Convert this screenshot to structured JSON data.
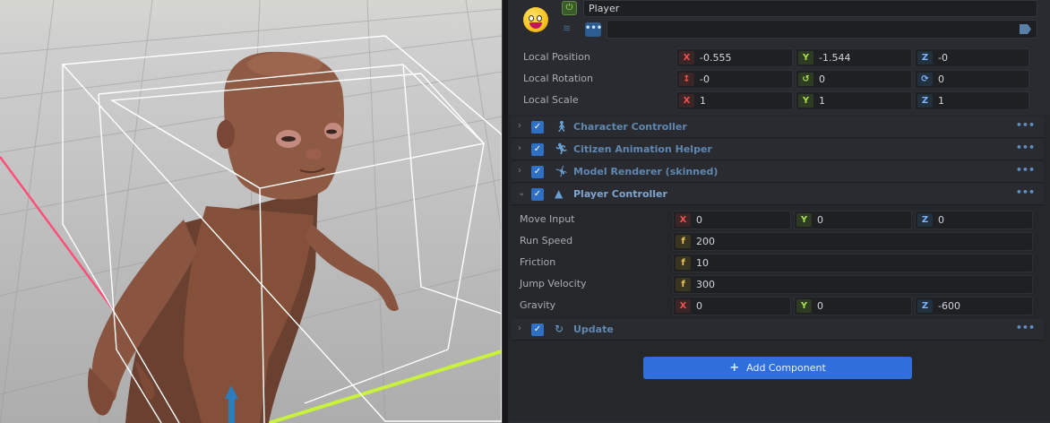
{
  "game_object": {
    "name": "Player",
    "tags": ""
  },
  "transform": {
    "position": {
      "label": "Local Position",
      "x": "-0.555",
      "y": "-1.544",
      "z": "-0"
    },
    "rotation": {
      "label": "Local Rotation",
      "x": "-0",
      "y": "0",
      "z": "0"
    },
    "scale": {
      "label": "Local Scale",
      "x": "1",
      "y": "1",
      "z": "1"
    }
  },
  "components": [
    {
      "title": "Character Controller",
      "icon": "walking-person-icon",
      "expanded": false
    },
    {
      "title": "Citizen Animation Helper",
      "icon": "running-person-icon",
      "expanded": false
    },
    {
      "title": "Model Renderer (skinned)",
      "icon": "pose-person-icon",
      "expanded": false
    },
    {
      "title": "Player Controller",
      "icon": "shapes-icon",
      "expanded": true
    },
    {
      "title": "Update",
      "icon": "refresh-icon",
      "expanded": false
    }
  ],
  "player_controller": {
    "move_input": {
      "label": "Move Input",
      "x": "0",
      "y": "0",
      "z": "0"
    },
    "run_speed": {
      "label": "Run Speed",
      "value": "200"
    },
    "friction": {
      "label": "Friction",
      "value": "10"
    },
    "jump_velocity": {
      "label": "Jump Velocity",
      "value": "300"
    },
    "gravity": {
      "label": "Gravity",
      "x": "0",
      "y": "0",
      "z": "-600"
    }
  },
  "axis_letters": {
    "x": "X",
    "y": "Y",
    "z": "Z",
    "f": "f"
  },
  "more_glyph": "•••",
  "add_component_label": "Add Component",
  "colors": {
    "accent_blue": "#2f6fdb",
    "axis_x": "#f05050",
    "axis_y": "#a6e04d",
    "axis_z": "#7ab6ff",
    "float": "#e8c25a"
  }
}
